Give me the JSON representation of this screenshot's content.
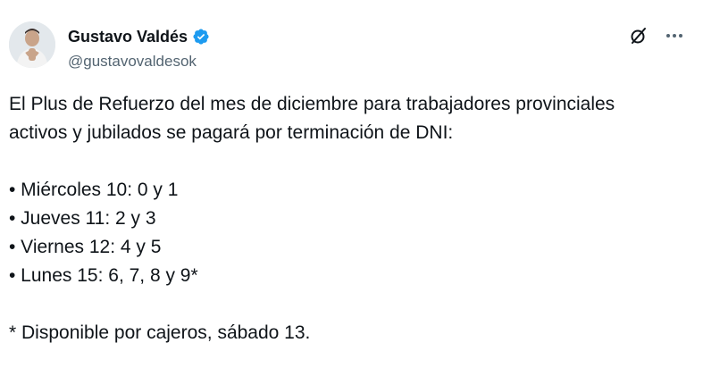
{
  "post": {
    "author": {
      "display_name": "Gustavo Valdés",
      "handle": "@gustavovaldesok",
      "verified": true
    },
    "icons": {
      "verified": "verified-badge-icon",
      "grok": "grok-icon",
      "more": "more-options-icon"
    },
    "colors": {
      "verified_blue": "#1d9bf0",
      "text": "#0f1419",
      "secondary_text": "#536471"
    },
    "text": {
      "line1": "El Plus de Refuerzo del mes de diciembre para trabajadores provinciales",
      "line2": "activos y jubilados se pagará por terminación de DNI:",
      "bullet1": "• Miércoles 10: 0 y 1",
      "bullet2": "• Jueves 11: 2 y 3",
      "bullet3": "• Viernes 12: 4 y 5",
      "bullet4": "• Lunes 15: 6, 7, 8 y 9*",
      "footnote": "* Disponible por cajeros, sábado 13."
    }
  }
}
